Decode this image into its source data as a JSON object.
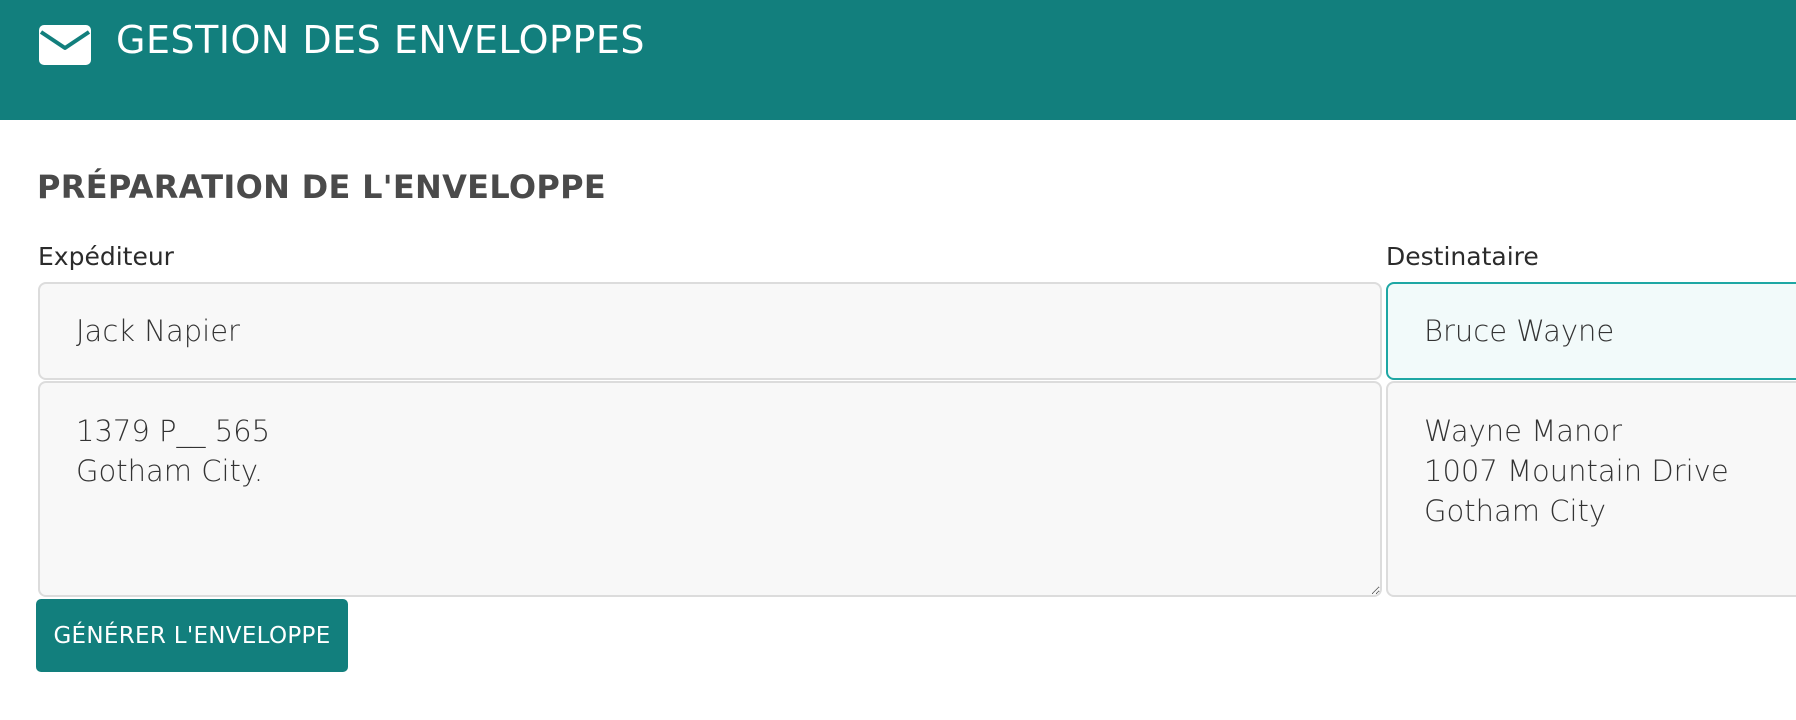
{
  "header": {
    "title": "GESTION DES ENVELOPPES",
    "icon": "envelope-icon",
    "background_color": "#127f7d"
  },
  "form": {
    "section_title": "PRÉPARATION DE L'ENVELOPPE",
    "sender": {
      "label": "Expéditeur",
      "name_value": "Jack Napier",
      "address_value": "1379 P__ 565\nGotham City."
    },
    "recipient": {
      "label": "Destinataire",
      "name_value": "Bruce Wayne",
      "address_value": "Wayne Manor\n1007 Mountain Drive\nGotham City",
      "focus_color": "#1ea7a4"
    },
    "generate_button_label": "GÉNÉRER L'ENVELOPPE"
  }
}
